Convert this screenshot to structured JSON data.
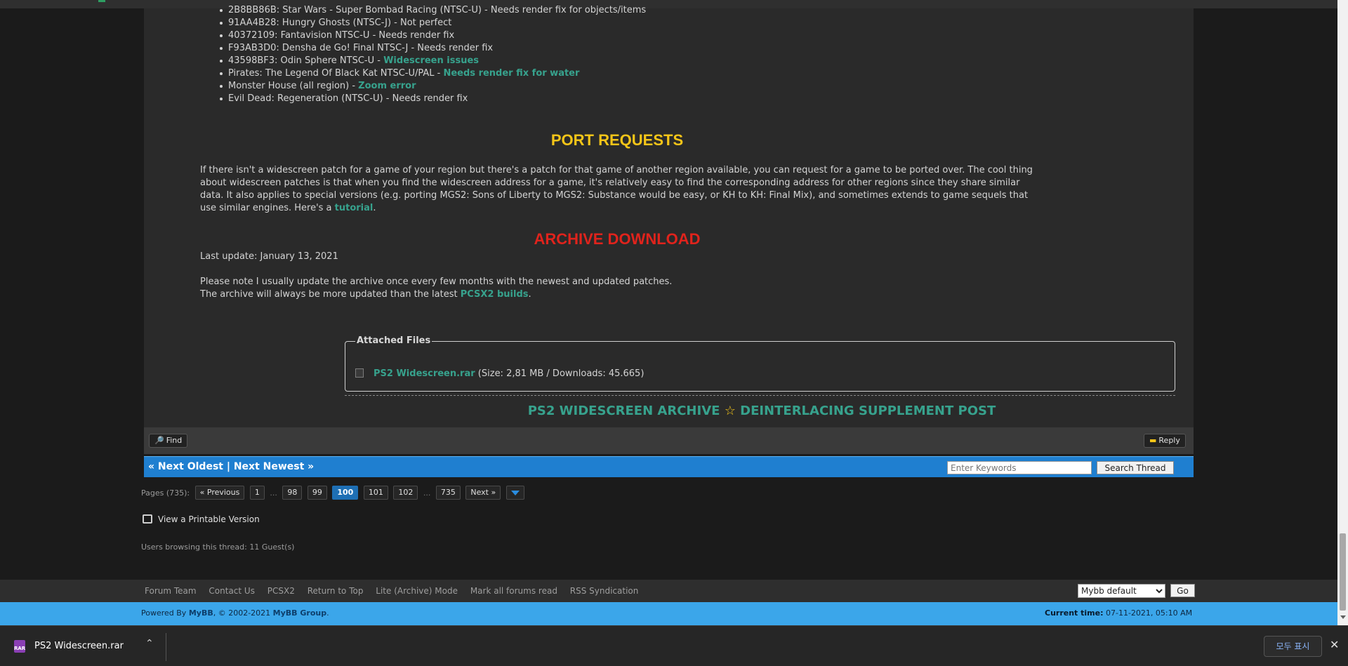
{
  "issues_list": [
    {
      "text": "2B8BB86B: Star Wars - Super Bombad Racing (NTSC-U) - Needs render fix for objects/items",
      "link": ""
    },
    {
      "text": "91AA4B28: Hungry Ghosts (NTSC-J) - Not perfect",
      "link": ""
    },
    {
      "text": "40372109: Fantavision NTSC-U - Needs render fix",
      "link": ""
    },
    {
      "text": "F93AB3D0: Densha de Go! Final NTSC-J - Needs render fix",
      "link": ""
    },
    {
      "text": "43598BF3: Odin Sphere NTSC-U - ",
      "link": "Widescreen issues"
    },
    {
      "text": "Pirates: The Legend Of Black Kat NTSC-U/PAL - ",
      "link": "Needs render fix for water"
    },
    {
      "text": "Monster House (all region) - ",
      "link": "Zoom error"
    },
    {
      "text": "Evil Dead: Regeneration (NTSC-U) - Needs render fix",
      "link": ""
    }
  ],
  "port_requests": {
    "heading": "PORT REQUESTS",
    "body": "If there isn't a widescreen patch for a game of your region but there's a patch for that game of another region available, you can request for a game to be ported over. The cool thing about widescreen patches is that when you find the widescreen address for a game, it's relatively easy to find the corresponding address for other regions since they share similar data. It also applies to special versions (e.g. porting MGS2: Sons of Liberty to MGS2: Substance would be easy, or KH to KH: Final Mix), and sometimes extends to game sequels that use similar engines. Here's a ",
    "link": "tutorial",
    "end": "."
  },
  "archive": {
    "heading": "ARCHIVE DOWNLOAD",
    "last_update": "Last update: January 13, 2021",
    "note1": "Please note I usually update the archive once every few months with the newest and updated patches.",
    "note2_pre": "The archive will always be more updated than the latest ",
    "note2_link": "PCSX2 builds",
    "note2_post": "."
  },
  "attached_files": {
    "legend": "Attached Files",
    "file_name": "PS2 Widescreen.rar",
    "file_info": " (Size: 2,81 MB / Downloads: 45.665)"
  },
  "supplement": {
    "left": "PS2 WIDESCREEN ARCHIVE",
    "star": "☆",
    "right": "DEINTERLACING SUPPLEMENT POST"
  },
  "post_tools": {
    "find": "Find",
    "reply": "Reply"
  },
  "thread_nav": {
    "text": "« Next Oldest | Next Newest »",
    "search_placeholder": "Enter Keywords",
    "search_button": "Search Thread"
  },
  "pagination": {
    "label": "Pages (735):",
    "previous": "« Previous",
    "pages": [
      "1",
      "...",
      "98",
      "99",
      "100",
      "101",
      "102",
      "...",
      "735"
    ],
    "current": "100",
    "next": "Next »"
  },
  "printable": "View a Printable Version",
  "users_browsing": "Users browsing this thread: 11 Guest(s)",
  "footer": {
    "links": [
      "Forum Team",
      "Contact Us",
      "PCSX2",
      "Return to Top",
      "Lite (Archive) Mode",
      "Mark all forums read",
      "RSS Syndication"
    ],
    "theme": "Mybb default",
    "go": "Go",
    "powered_pre": "Powered By ",
    "powered_link1": "MyBB",
    "powered_mid": ", © 2002-2021 ",
    "powered_link2": "MyBB Group",
    "powered_post": ".",
    "time_label": "Current time:",
    "time_value": "07-11-2021, 05:10 AM"
  },
  "download_bar": {
    "icon_label": "RAR",
    "file_name": "PS2 Widescreen.rar",
    "show_all": "모두 표시"
  },
  "colors": {
    "heading_yellow": "#f5c518",
    "heading_red": "#e0231c",
    "link_teal": "#37a28d",
    "nav_blue": "#1f7fd0"
  }
}
